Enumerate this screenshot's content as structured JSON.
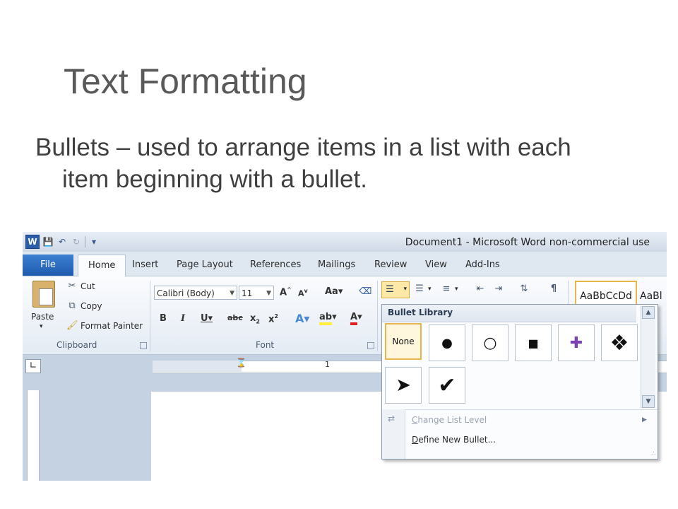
{
  "slide": {
    "title": "Text Formatting",
    "body_line1": "Bullets – used to arrange items in a list with each",
    "body_line2": "item beginning with a bullet."
  },
  "app": {
    "logo": "W",
    "window_title": "Document1  -  Microsoft Word non-commercial use"
  },
  "tabs": {
    "file": "File",
    "home": "Home",
    "insert": "Insert",
    "page_layout": "Page Layout",
    "references": "References",
    "mailings": "Mailings",
    "review": "Review",
    "view": "View",
    "addins": "Add-Ins",
    "active": "Home"
  },
  "clipboard": {
    "paste": "Paste",
    "cut": "Cut",
    "copy": "Copy",
    "format_painter": "Format Painter",
    "group_label": "Clipboard"
  },
  "font": {
    "font_name": "Calibri (Body)",
    "font_size": "11",
    "group_label": "Font"
  },
  "styles": {
    "normal_preview": "AaBbCcDd",
    "next_preview": "AaBl"
  },
  "ruler": {
    "mark": "1"
  },
  "bullet_menu": {
    "header": "Bullet Library",
    "none_label": "None",
    "bullets": [
      "●",
      "○",
      "■",
      "✚",
      "❖",
      "➤",
      "✔"
    ],
    "change_level_prefix": "C",
    "change_level_rest": "hange List Level",
    "define_prefix": "D",
    "define_rest": "efine New Bullet..."
  },
  "colors": {
    "file_tab": "#2a6bc4",
    "selection": "#e8b54a",
    "title_text": "#595959"
  },
  "icons": [
    "word-logo-icon",
    "save-icon",
    "undo-icon",
    "redo-icon",
    "customize-icon",
    "cut-icon",
    "copy-icon",
    "format-painter-icon",
    "bullets-icon",
    "numbering-icon",
    "multilevel-icon",
    "show-hide-icon"
  ]
}
